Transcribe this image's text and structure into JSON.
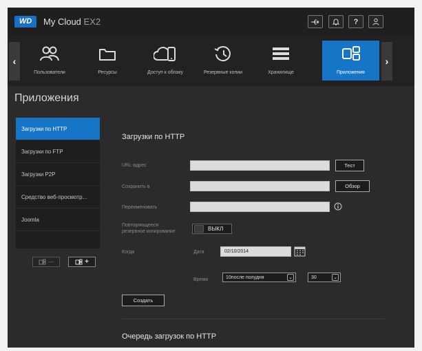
{
  "header": {
    "brand_logo": "WD",
    "app_name": "My Cloud",
    "app_model": "EX2",
    "buttons": {
      "usb_icon": "usb-icon",
      "bell_icon": "bell-icon",
      "help_label": "?",
      "user_icon": "user-icon"
    }
  },
  "nav": {
    "items": [
      {
        "label": "Пользователи",
        "icon": "users-icon"
      },
      {
        "label": "Ресурсы",
        "icon": "folder-icon"
      },
      {
        "label": "Доступ к облаку",
        "icon": "cloud-access-icon"
      },
      {
        "label": "Резервные копии",
        "icon": "backup-clock-icon"
      },
      {
        "label": "Хранилище",
        "icon": "storage-icon"
      },
      {
        "label": "Приложения",
        "icon": "apps-icon"
      }
    ],
    "active_index": 5
  },
  "page": {
    "title": "Приложения"
  },
  "sidebar": {
    "items": [
      {
        "label": "Загрузки по HTTP"
      },
      {
        "label": "Загрузки по FTP"
      },
      {
        "label": "Загрузки P2P"
      },
      {
        "label": "Средство веб-просмотр..."
      },
      {
        "label": "Joomla"
      }
    ],
    "active_index": 0,
    "remove_label": "—",
    "add_label": "+"
  },
  "main": {
    "section_title": "Загрузки по HTTP",
    "url_label": "URL-адрес",
    "url_value": "",
    "test_button": "Тест",
    "save_to_label": "Сохранить в",
    "save_to_value": "",
    "browse_button": "Обзор",
    "rename_label": "Переименовать",
    "rename_value": "",
    "recurring_label_1": "Повторяющееся",
    "recurring_label_2": "резервное копирование",
    "recurring_state": "ВЫКЛ",
    "when_label": "Когда",
    "date_label": "Дата",
    "date_value": "02/10/2014",
    "time_label": "Время",
    "hour_value": "10после полудня",
    "minute_value": "30",
    "create_button": "Создать",
    "queue_title": "Очередь загрузок по HTTP"
  },
  "colors": {
    "accent": "#1675c7",
    "background": "#2b2b2b",
    "input": "#dcdcdc"
  }
}
